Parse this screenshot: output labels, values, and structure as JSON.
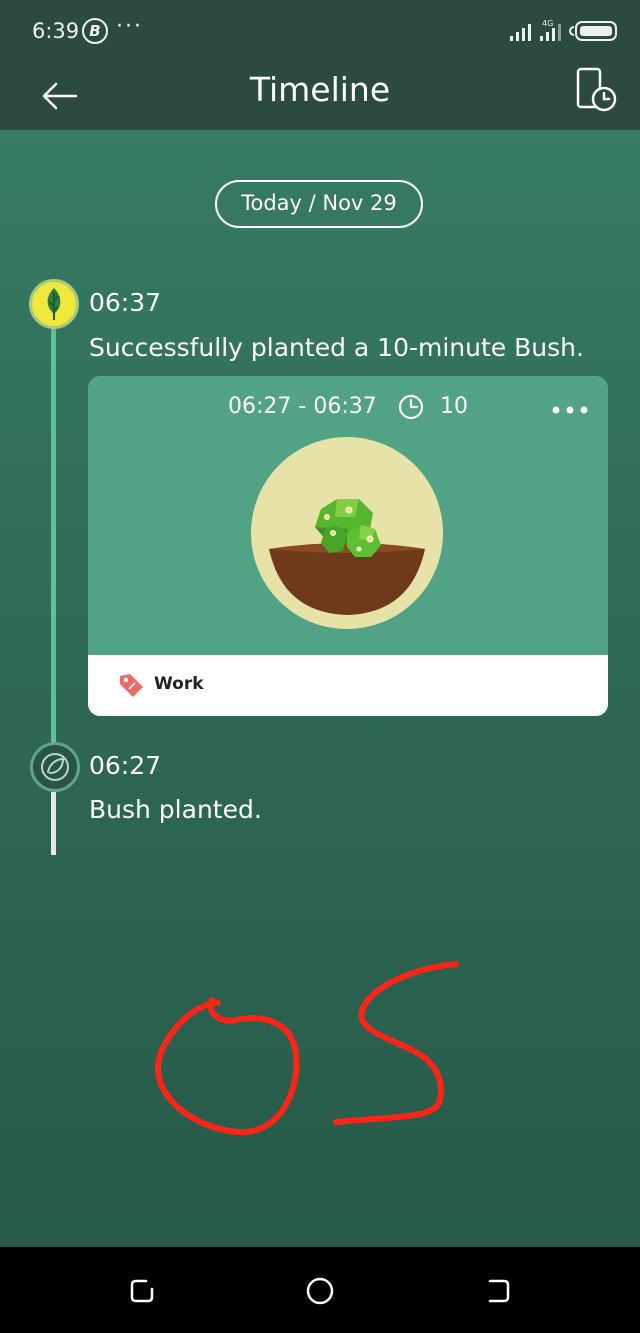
{
  "status_bar": {
    "time": "6:39",
    "badge": "B",
    "dots": "···",
    "network": "4G"
  },
  "header": {
    "title": "Timeline",
    "back_icon": "arrow-left-icon",
    "history_icon": "phone-clock-icon"
  },
  "date_filter": {
    "label": "Today / Nov 29"
  },
  "entries": [
    {
      "time": "06:37",
      "text": "Successfully planted a 10-minute Bush.",
      "icon": "sprout-leaf-icon",
      "card": {
        "range": "06:27 - 06:37",
        "duration": "10",
        "tag": "Work",
        "tree": "bush-illustration"
      }
    },
    {
      "time": "06:27",
      "text": "Bush planted.",
      "icon": "seed-icon"
    }
  ],
  "colors": {
    "background": "#2f6b55",
    "header": "#2a4b3e",
    "card": "#52a386",
    "timeline_line": "#5fbf96",
    "node_active": "#f0e93c",
    "scribble": "#ff2418",
    "tag": "#e96c68"
  },
  "annotation": {
    "scribble_text": "OS"
  },
  "nav_bar": {
    "items": [
      "recent-apps-icon",
      "home-icon",
      "back-icon"
    ]
  }
}
